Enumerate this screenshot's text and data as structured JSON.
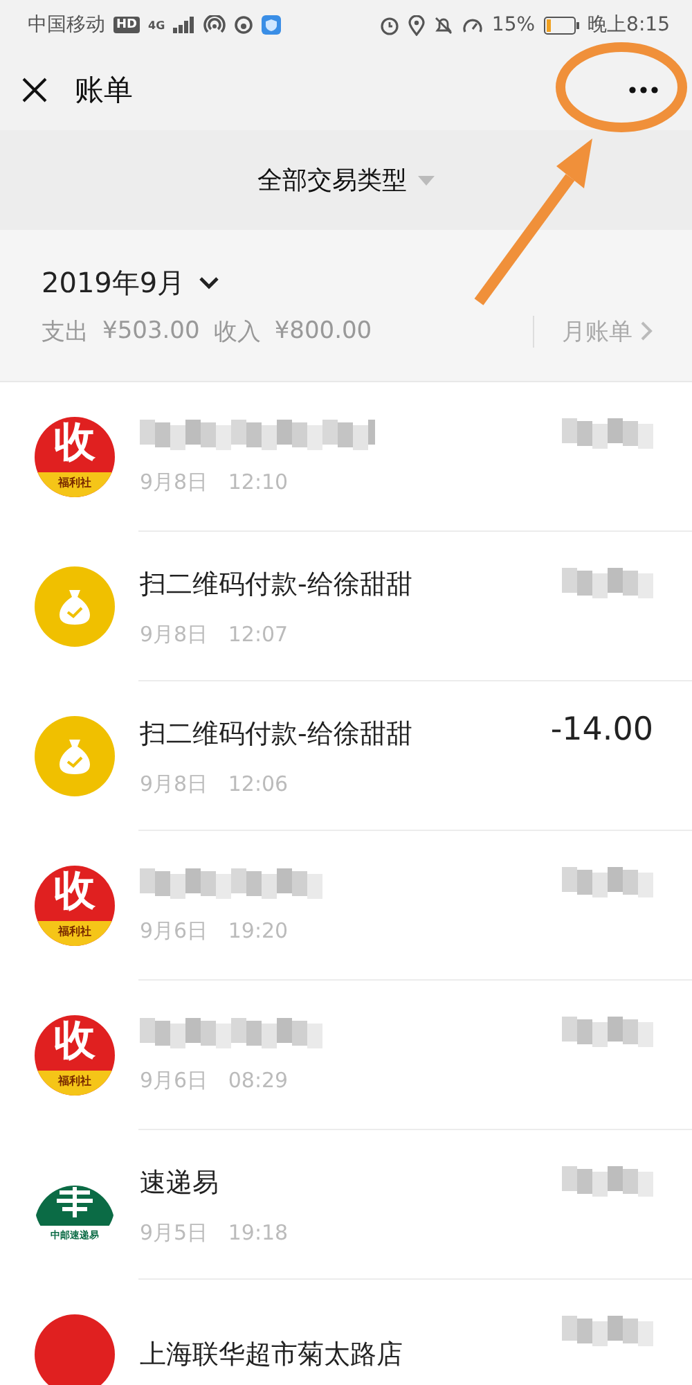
{
  "status_bar": {
    "carrier": "中国移动",
    "hd_badge": "HD",
    "network": "4G",
    "battery_text": "15%",
    "time": "晚上8:15"
  },
  "header": {
    "title": "账单"
  },
  "filter": {
    "label": "全部交易类型"
  },
  "month": {
    "label": "2019年9月",
    "expense_label": "支出",
    "expense": "¥503.00",
    "income_label": "收入",
    "income": "¥800.00",
    "monthly_link": "月账单"
  },
  "transactions": [
    {
      "kind": "shou",
      "avatar_text": "收",
      "avatar_caption": "福利社",
      "title_blurred": true,
      "date": "9月8日",
      "time": "12:10",
      "amount_blurred": true
    },
    {
      "kind": "moneybag",
      "title": "扫二维码付款-给徐甜甜",
      "title_blurred": false,
      "date": "9月8日",
      "time": "12:07",
      "amount_blurred": true
    },
    {
      "kind": "moneybag",
      "title": "扫二维码付款-给徐甜甜",
      "title_blurred": false,
      "date": "9月8日",
      "time": "12:06",
      "amount": "-14.00",
      "amount_blurred": false
    },
    {
      "kind": "shou",
      "avatar_text": "收",
      "avatar_caption": "福利社",
      "title_blurred": true,
      "date": "9月6日",
      "time": "19:20",
      "amount_blurred": true
    },
    {
      "kind": "shou",
      "avatar_text": "收",
      "avatar_caption": "福利社",
      "title_blurred": true,
      "date": "9月6日",
      "time": "08:29",
      "amount_blurred": true
    },
    {
      "kind": "post",
      "avatar_caption": "中邮速递易",
      "title": "速递易",
      "title_blurred": false,
      "date": "9月5日",
      "time": "19:18",
      "amount_blurred": true
    },
    {
      "kind": "shou",
      "title": "上海联华超市菊太路店",
      "title_blurred": false,
      "amount_blurred": true
    }
  ]
}
